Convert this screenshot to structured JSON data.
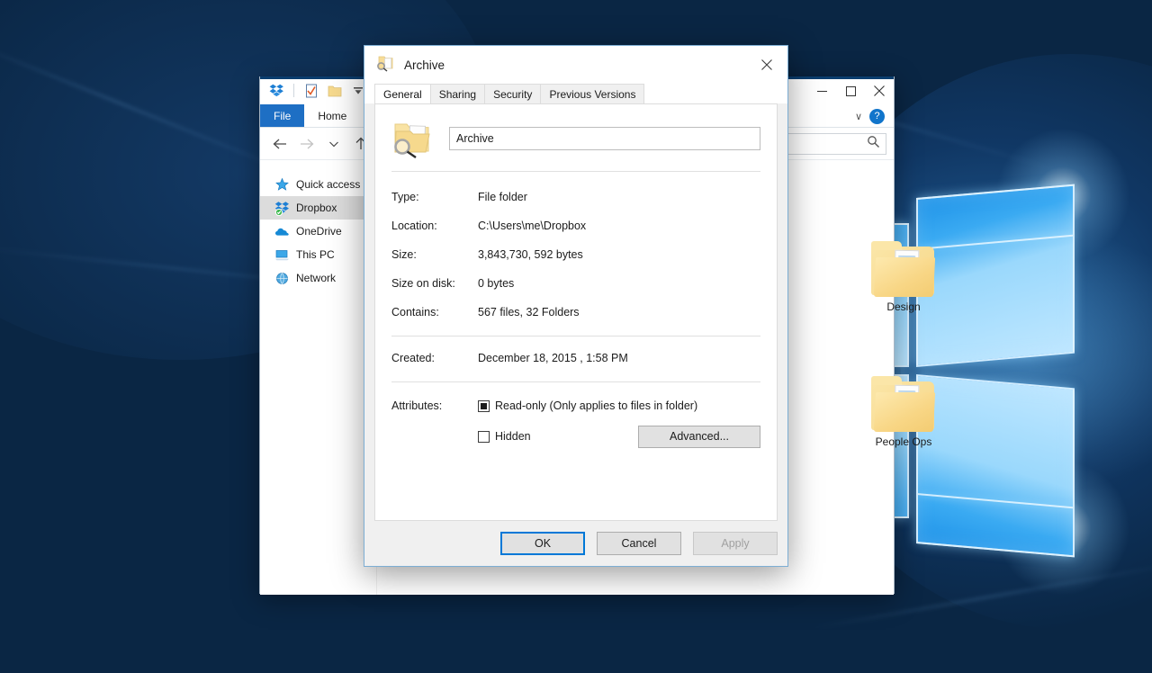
{
  "desktop": {
    "wallpaper_name": "windows-10-hero-logo",
    "bg_color": "#0a2644",
    "logo_accent": "#3aaaf2"
  },
  "explorer": {
    "quick_access_toolbar": [
      {
        "name": "dropbox-icon",
        "label": "Dropbox"
      },
      {
        "name": "properties-icon",
        "label": "Properties"
      },
      {
        "name": "new-folder-icon",
        "label": "New folder"
      },
      {
        "name": "customize-qat-icon",
        "label": "Customize Quick Access Toolbar"
      }
    ],
    "window_controls": {
      "minimize": "–",
      "maximize": "☐",
      "close": "✕"
    },
    "ribbon_tabs": [
      {
        "label": "File",
        "active": true
      },
      {
        "label": "Home",
        "active": false
      }
    ],
    "ribbon_right": {
      "collapse": "∨",
      "help": "?"
    },
    "nav_buttons": {
      "back": "←",
      "forward": "→",
      "recent": "∨",
      "up": "↑"
    },
    "search": {
      "placeholder": "",
      "value": "",
      "icon": "search-icon"
    },
    "sidebar": {
      "items": [
        {
          "label": "Quick access",
          "icon": "star-icon",
          "selected": false
        },
        {
          "label": "Dropbox",
          "icon": "dropbox-icon",
          "selected": true
        },
        {
          "label": "OneDrive",
          "icon": "cloud-icon",
          "selected": false
        },
        {
          "label": "This PC",
          "icon": "monitor-icon",
          "selected": false
        },
        {
          "label": "Network",
          "icon": "network-icon",
          "selected": false
        }
      ]
    },
    "content": {
      "folders": [
        {
          "label": "Design"
        },
        {
          "label": "People Ops"
        }
      ]
    }
  },
  "dialog": {
    "title": "Archive",
    "title_icon": "folder-search-icon",
    "close_glyph": "✕",
    "tabs": [
      {
        "label": "General",
        "active": true
      },
      {
        "label": "Sharing",
        "active": false
      },
      {
        "label": "Security",
        "active": false
      },
      {
        "label": "Previous Versions",
        "active": false
      }
    ],
    "general": {
      "folder_icon": "folder-search-icon",
      "name_value": "Archive",
      "name_placeholder": "",
      "properties": [
        {
          "key": "Type:",
          "value": "File folder"
        },
        {
          "key": "Location:",
          "value": "C:\\Users\\me\\Dropbox"
        },
        {
          "key": "Size:",
          "value": "3,843,730, 592 bytes"
        },
        {
          "key": "Size on disk:",
          "value": "0 bytes"
        },
        {
          "key": "Contains:",
          "value": "567 files, 32 Folders"
        }
      ],
      "created": {
        "key": "Created:",
        "value": "December 18, 2015 , 1:58 PM"
      },
      "attributes": {
        "key": "Attributes:",
        "readonly": {
          "label": "Read-only (Only applies to files in folder)",
          "state": "indeterminate"
        },
        "hidden": {
          "label": "Hidden",
          "state": "unchecked"
        },
        "advanced_button": "Advanced..."
      }
    },
    "footer": {
      "ok": "OK",
      "cancel": "Cancel",
      "apply": "Apply",
      "apply_disabled": true,
      "focus_color": "#0078d7"
    }
  }
}
